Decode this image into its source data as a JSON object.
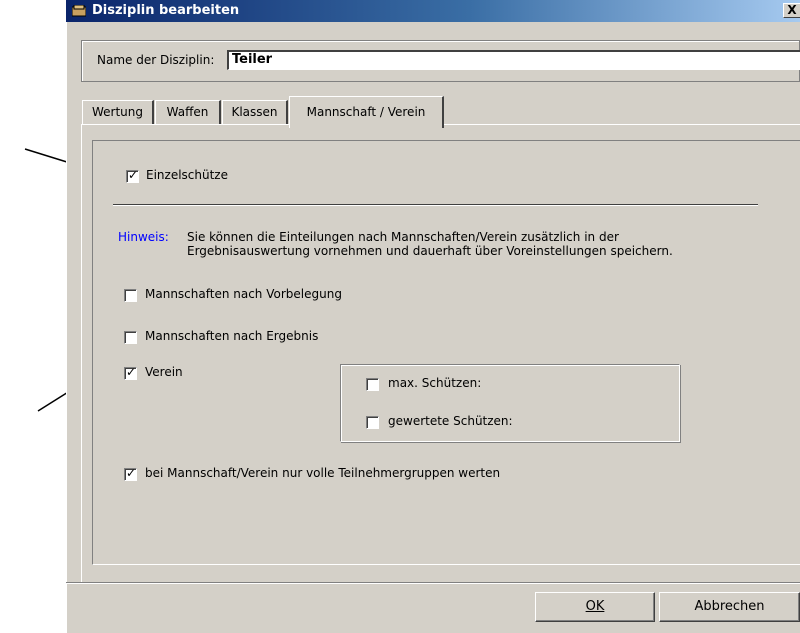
{
  "window": {
    "title": "Disziplin bearbeiten",
    "close_label": "X"
  },
  "name_field": {
    "label": "Name der Disziplin:",
    "value": "Teiler"
  },
  "tabs": [
    {
      "label": "Wertung"
    },
    {
      "label": "Waffen"
    },
    {
      "label": "Klassen"
    },
    {
      "label": "Mannschaft / Verein",
      "active": true
    }
  ],
  "options": {
    "einzelschuetze": {
      "label": "Einzelschütze",
      "checked": true
    },
    "hinweis_label": "Hinweis:",
    "hinweis_text_1": "Sie können die Einteilungen nach Mannschaften/Verein zusätzlich in der",
    "hinweis_text_2": "Ergebnisauswertung vornehmen und dauerhaft über Voreinstellungen speichern.",
    "mannschaften_vorbelegung": {
      "label": "Mannschaften nach Vorbelegung",
      "checked": false
    },
    "mannschaften_ergebnis": {
      "label": "Mannschaften nach Ergebnis",
      "checked": false
    },
    "verein": {
      "label": "Verein",
      "checked": true
    },
    "max_schuetzen": {
      "label": "max. Schützen:",
      "checked": false
    },
    "gewertete_schuetzen": {
      "label": "gewertete Schützen:",
      "checked": false
    },
    "volle_gruppen": {
      "label": "bei Mannschaft/Verein nur volle Teilnehmergruppen werten",
      "checked": true
    }
  },
  "buttons": {
    "ok": "OK",
    "cancel": "Abbrechen"
  },
  "colors": {
    "dialog_bg": "#d4d0c8",
    "titlebar": "#0a246a",
    "hint": "#0000ff"
  }
}
